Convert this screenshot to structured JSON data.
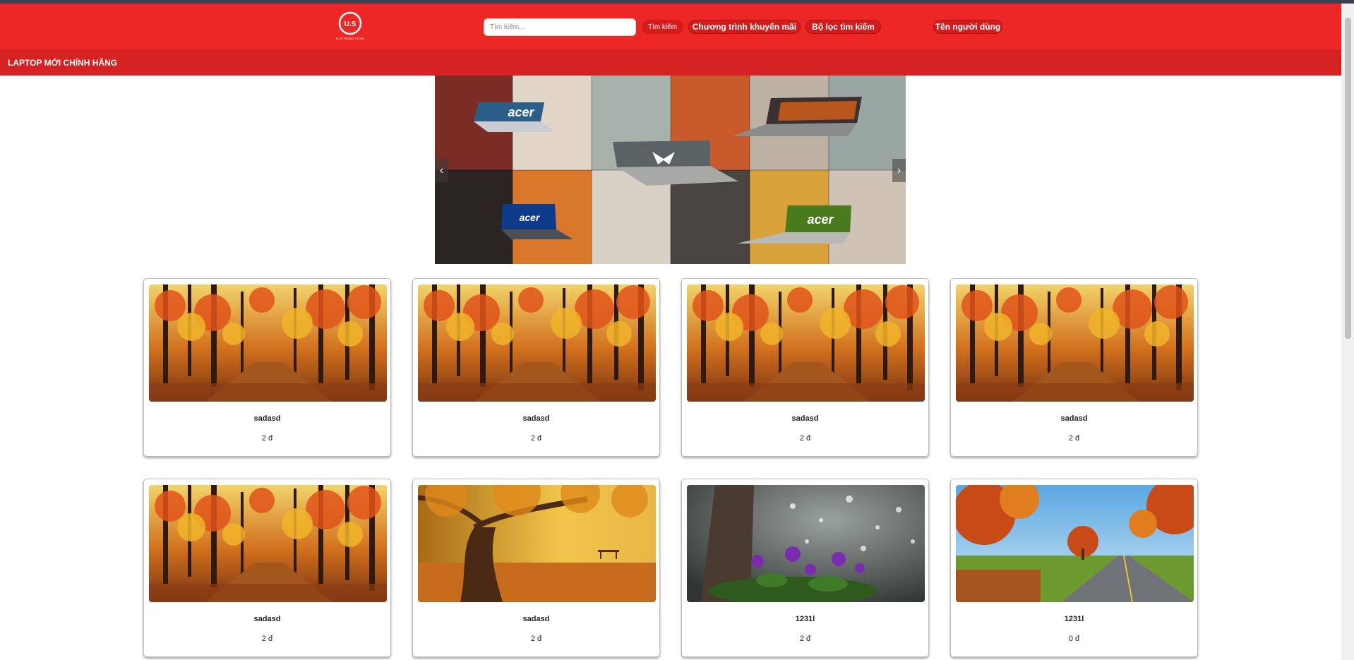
{
  "header": {
    "logo_text": "U.S",
    "logo_subtext": "ELECTRONIC STORE",
    "search_placeholder": "Tìm kiếm...",
    "search_button": "Tìm kiếm",
    "promo_button": "Chương trình khuyến mãi",
    "filter_button": "Bộ lọc tìm kiếm",
    "user_button": "Tên người dùng"
  },
  "subbar": {
    "title": "LAPTOP MỚI CHÍNH HÃNG"
  },
  "carousel": {
    "logos": [
      "acer",
      "acer",
      "acer",
      "acer"
    ],
    "prev_icon": "chevron-left-icon",
    "next_icon": "chevron-right-icon"
  },
  "products": [
    {
      "name": "sadasd",
      "price": "2 đ",
      "image": "autumn-forest-path"
    },
    {
      "name": "sadasd",
      "price": "2 đ",
      "image": "autumn-forest-path"
    },
    {
      "name": "sadasd",
      "price": "2 đ",
      "image": "autumn-forest-path"
    },
    {
      "name": "sadasd",
      "price": "2 đ",
      "image": "autumn-forest-path"
    },
    {
      "name": "sadasd",
      "price": "2 đ",
      "image": "autumn-forest-path"
    },
    {
      "name": "sadasd",
      "price": "2 đ",
      "image": "autumn-tree-park"
    },
    {
      "name": "1231l",
      "price": "2 đ",
      "image": "violet-flowers-rain"
    },
    {
      "name": "1231l",
      "price": "0 đ",
      "image": "autumn-road"
    }
  ],
  "colors": {
    "header_red": "#ed2626",
    "subbar_red": "#d42222",
    "button_red": "#d41c1c"
  }
}
